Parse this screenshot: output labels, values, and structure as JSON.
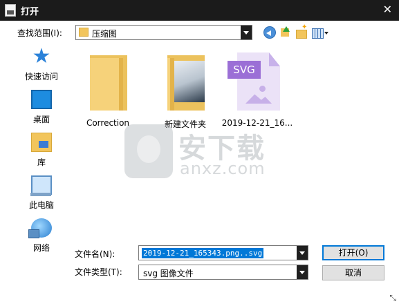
{
  "window": {
    "title": "打开",
    "close_glyph": "✕"
  },
  "toolbar": {
    "look_in_label": "查找范围(I):",
    "look_in_value": "压缩图",
    "icons": [
      "back-icon",
      "up-folder-icon",
      "new-folder-icon",
      "view-menu-icon"
    ]
  },
  "places": [
    {
      "label": "快速访问",
      "icon": "quick-access-icon"
    },
    {
      "label": "桌面",
      "icon": "desktop-icon"
    },
    {
      "label": "库",
      "icon": "library-icon"
    },
    {
      "label": "此电脑",
      "icon": "this-pc-icon"
    },
    {
      "label": "网络",
      "icon": "network-icon"
    }
  ],
  "files": [
    {
      "name": "Correction",
      "type": "folder"
    },
    {
      "name": "新建文件夹",
      "type": "folder-with-preview"
    },
    {
      "name": "2019-12-21_16...",
      "type": "svg-file",
      "badge": "SVG"
    }
  ],
  "watermark": {
    "cn": "安下载",
    "en": "anxz.com"
  },
  "form": {
    "filename_label": "文件名(N):",
    "filename_value": "2019-12-21_165343.png..svg",
    "filetype_label": "文件类型(T):",
    "filetype_value": "svg 图像文件"
  },
  "buttons": {
    "open": "打开(O)",
    "cancel": "取消"
  },
  "colors": {
    "titlebar": "#1b1b1b",
    "accent": "#0078d7",
    "folder": "#f2c55c",
    "svg_badge": "#9b6fd6"
  }
}
